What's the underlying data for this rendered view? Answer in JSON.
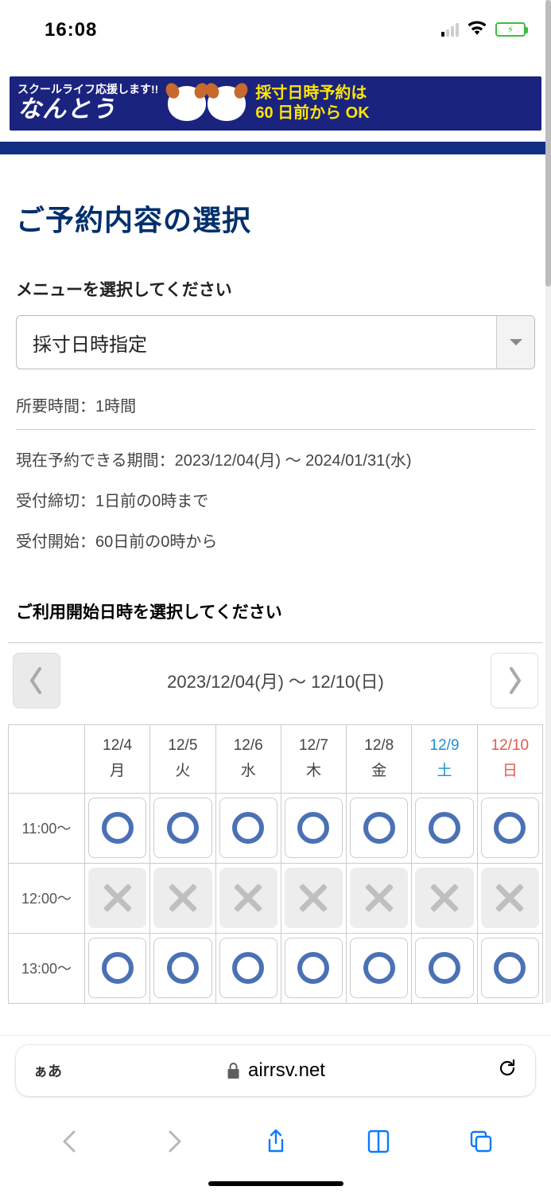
{
  "status": {
    "time": "16:08"
  },
  "banner": {
    "small_text": "スクールライフ応援します!!",
    "brand": "なんとう",
    "promo_line1": "採寸日時予約は",
    "promo_line2": "60 日前から OK"
  },
  "page_title": "ご予約内容の選択",
  "menu_prompt": "メニューを選択してください",
  "dropdown_value": "採寸日時指定",
  "info": {
    "duration": "所要時間：1時間",
    "period": "現在予約できる期間：2023/12/04(月) 〜 2024/01/31(水)",
    "deadline": "受付締切：1日前の0時まで",
    "start": "受付開始：60日前の0時から"
  },
  "date_prompt": "ご利用開始日時を選択してください",
  "week_range": "2023/12/04(月) 〜 12/10(日)",
  "days": [
    {
      "date": "12/4",
      "dow": "月",
      "cls": ""
    },
    {
      "date": "12/5",
      "dow": "火",
      "cls": ""
    },
    {
      "date": "12/6",
      "dow": "水",
      "cls": ""
    },
    {
      "date": "12/7",
      "dow": "木",
      "cls": ""
    },
    {
      "date": "12/8",
      "dow": "金",
      "cls": ""
    },
    {
      "date": "12/9",
      "dow": "土",
      "cls": "sat"
    },
    {
      "date": "12/10",
      "dow": "日",
      "cls": "sun"
    }
  ],
  "rows": [
    {
      "time": "11:00〜",
      "slots": [
        "avail",
        "avail",
        "avail",
        "avail",
        "avail",
        "avail",
        "avail"
      ]
    },
    {
      "time": "12:00〜",
      "slots": [
        "full",
        "full",
        "full",
        "full",
        "full",
        "full",
        "full"
      ]
    },
    {
      "time": "13:00〜",
      "slots": [
        "avail",
        "avail",
        "avail",
        "avail",
        "avail",
        "avail",
        "avail"
      ]
    }
  ],
  "safari": {
    "aa": "ぁあ",
    "url": "airrsv.net"
  }
}
